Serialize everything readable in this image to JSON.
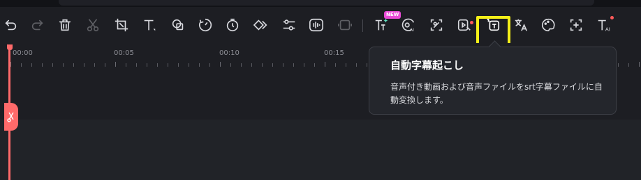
{
  "toolbar": {
    "new_badge": "NEW",
    "tools": [
      {
        "name": "undo-button",
        "icon": "undo-icon"
      },
      {
        "name": "redo-button",
        "icon": "redo-icon"
      },
      {
        "name": "delete-button",
        "icon": "trash-icon"
      },
      {
        "name": "cut-button",
        "icon": "scissors-icon"
      },
      {
        "name": "crop-button",
        "icon": "crop-icon"
      },
      {
        "name": "text-button",
        "icon": "text-icon"
      },
      {
        "name": "shape-button",
        "icon": "shape-icon"
      },
      {
        "name": "speed-button",
        "icon": "speed-icon"
      },
      {
        "name": "timer-button",
        "icon": "stopwatch-icon"
      },
      {
        "name": "keyframe-button",
        "icon": "keyframe-icon"
      },
      {
        "name": "adjust-button",
        "icon": "sliders-icon"
      },
      {
        "name": "audio-button",
        "icon": "waveform-icon"
      },
      {
        "name": "freeze-button",
        "icon": "freeze-frame-icon"
      },
      {
        "name": "ai-effect-button",
        "icon": "sparkle-text-icon"
      },
      {
        "name": "ai-color-button",
        "icon": "ai-palette-icon"
      },
      {
        "name": "ai-image-button",
        "icon": "ai-image-icon"
      },
      {
        "name": "ai-video-button",
        "icon": "ai-video-icon"
      },
      {
        "name": "auto-subtitle-button",
        "icon": "auto-caption-icon"
      },
      {
        "name": "translate-button",
        "icon": "translate-icon"
      },
      {
        "name": "ai-palette-button",
        "icon": "ai-color-palette-icon"
      },
      {
        "name": "ai-crop-button",
        "icon": "ai-frame-icon"
      },
      {
        "name": "ai-text-button",
        "icon": "ai-text-icon"
      }
    ]
  },
  "timeline": {
    "labels": [
      "00:00",
      "00:05",
      "00:10",
      "00:15"
    ]
  },
  "tooltip": {
    "title": "自動字幕起こし",
    "description": "音声付き動画および音声ファイルをsrt字幕ファイルに自動変換します。"
  },
  "colors": {
    "highlight": "#f5ef19",
    "playhead": "#ff6a6a",
    "badge": "#e94bd6"
  }
}
